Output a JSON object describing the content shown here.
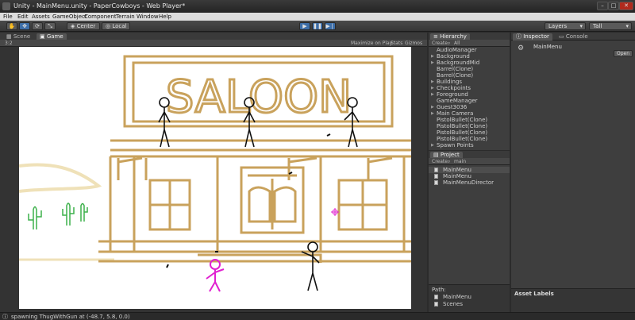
{
  "window": {
    "title": "Unity - MainMenu.unity - PaperCowboys - Web Player*",
    "min": "–",
    "max": "□",
    "close": "✕"
  },
  "menu": [
    "File",
    "Edit",
    "Assets",
    "GameObject",
    "Component",
    "Terrain",
    "Window",
    "Help"
  ],
  "toolbar": {
    "pivot": "Center",
    "space": "Local",
    "layers": "Layers",
    "layout": "Tall"
  },
  "scene_tabs": {
    "scene": "Scene",
    "game": "Game",
    "aspect": "3:2",
    "maximize": "Maximize on Play",
    "stats": "Stats",
    "gizmos": "Gizmos"
  },
  "hierarchy": {
    "tab": "Hierarchy",
    "create": "Create",
    "search": "All",
    "items": [
      {
        "label": "AudioManager",
        "expandable": false
      },
      {
        "label": "Background",
        "expandable": true
      },
      {
        "label": "BackgroundMid",
        "expandable": true
      },
      {
        "label": "Barrel(Clone)",
        "expandable": false
      },
      {
        "label": "Barrel(Clone)",
        "expandable": false
      },
      {
        "label": "Buildings",
        "expandable": true
      },
      {
        "label": "Checkpoints",
        "expandable": true
      },
      {
        "label": "Foreground",
        "expandable": true
      },
      {
        "label": "GameManager",
        "expandable": false
      },
      {
        "label": "Guest3036",
        "expandable": true
      },
      {
        "label": "Main Camera",
        "expandable": true
      },
      {
        "label": "PistolBullet(Clone)",
        "expandable": false
      },
      {
        "label": "PistolBullet(Clone)",
        "expandable": false
      },
      {
        "label": "PistolBullet(Clone)",
        "expandable": false
      },
      {
        "label": "PistolBullet(Clone)",
        "expandable": false
      },
      {
        "label": "Spawn Points",
        "expandable": true
      }
    ]
  },
  "project": {
    "tab": "Project",
    "create": "Create",
    "search": "main",
    "items": [
      "MainMenu",
      "MainMenu",
      "MainMenuDirector"
    ],
    "path_label": "Path:",
    "path_items": [
      "MainMenu",
      "Scenes"
    ]
  },
  "inspector": {
    "tab": "Inspector",
    "console_tab": "Console",
    "object": "MainMenu",
    "open": "Open",
    "asset_labels": "Asset Labels"
  },
  "game": {
    "sign": "SALOON",
    "player_color": "#e020d0",
    "ink_color": "#c9a25c"
  },
  "status": {
    "message": "spawning ThugWithGun at (-48.7, 5.8, 0.0)"
  }
}
